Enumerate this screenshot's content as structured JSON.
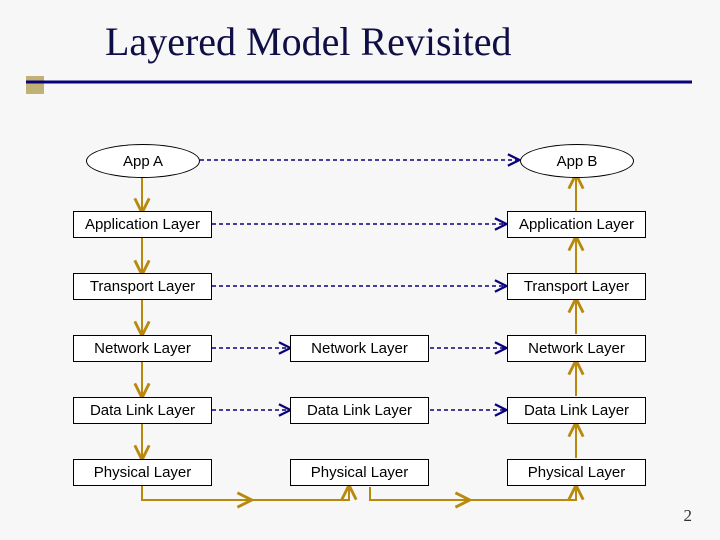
{
  "title": "Layered Model Revisited",
  "slide_number": "2",
  "col": {
    "left": {
      "app": "App A",
      "application": "Application Layer",
      "transport": "Transport Layer",
      "network": "Network Layer",
      "datalink": "Data Link Layer",
      "physical": "Physical Layer"
    },
    "mid": {
      "network": "Network Layer",
      "datalink": "Data Link Layer",
      "physical": "Physical Layer"
    },
    "right": {
      "app": "App B",
      "application": "Application Layer",
      "transport": "Transport Layer",
      "network": "Network Layer",
      "datalink": "Data Link Layer",
      "physical": "Physical Layer"
    }
  }
}
